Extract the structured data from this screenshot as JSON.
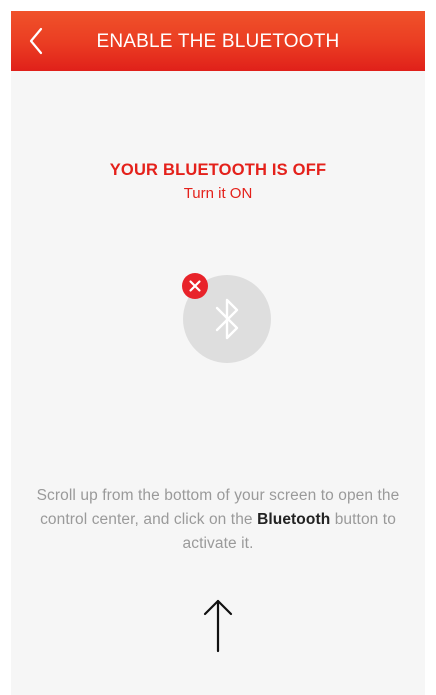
{
  "header": {
    "title": "ENABLE THE BLUETOOTH",
    "back_icon": "chevron-left-icon",
    "background_color": "#ea3c22",
    "text_color": "#ffffff"
  },
  "status": {
    "title": "YOUR BLUETOOTH IS OFF",
    "subtitle": "Turn it ON",
    "color": "#e4211b"
  },
  "bluetooth_indicator": {
    "icon": "bluetooth-icon",
    "badge_icon": "close-icon",
    "badge_color": "#e8232a"
  },
  "instructions": {
    "before": "Scroll up from the bottom of your screen to open the control center, and click on the ",
    "highlight": "Bluetooth",
    "after": " button to activate it."
  },
  "footer": {
    "arrow_icon": "arrow-up-icon"
  }
}
